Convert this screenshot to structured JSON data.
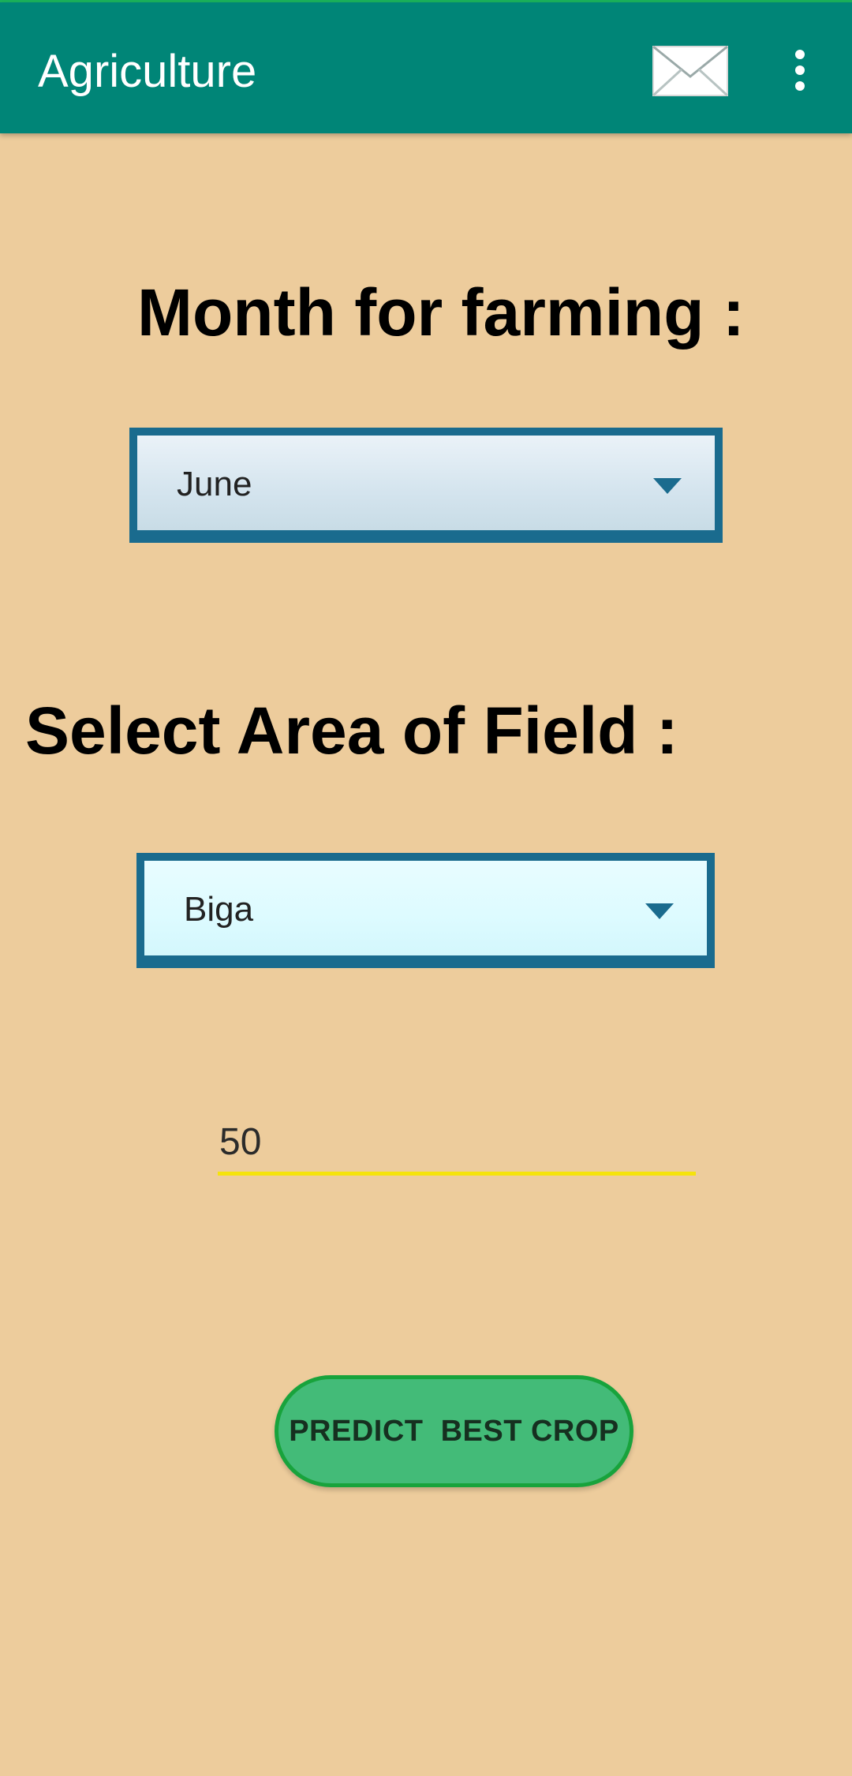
{
  "appbar": {
    "title": "Agriculture",
    "color": "#008577",
    "mail_icon": "mail-envelope-icon",
    "overflow_icon": "more-vert-icon"
  },
  "month_section": {
    "heading": "Month for farming :",
    "selected": "June",
    "arrow_icon": "dropdown-arrow-icon"
  },
  "area_section": {
    "heading": "Select Area of Field :",
    "selected": "Biga",
    "arrow_icon": "dropdown-arrow-icon"
  },
  "area_input": {
    "value": "50",
    "underline_color": "#F5E30C"
  },
  "predict_button": {
    "label": "PREDICT  BEST CROP",
    "color": "#43BB78"
  },
  "colors": {
    "background": "#EDCC9C",
    "spinner_border": "#1A6B8E"
  }
}
